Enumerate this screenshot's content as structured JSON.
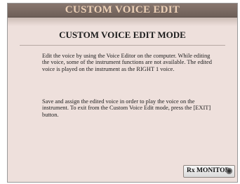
{
  "window": {
    "title": "CUSTOM VOICE EDIT"
  },
  "content": {
    "heading": "CUSTOM VOICE EDIT MODE",
    "paragraph1": "Edit the voice by using the Voice Editor on the computer. While editing the voice, some of the instrument functions are not available. The edited voice is played on the instrument as the RIGHT 1 voice.",
    "paragraph2": "Save and assign the edited voice in order to play the voice on the instrument. To exit from the Custom Voice Edit mode, press the [EXIT] button."
  },
  "monitor": {
    "label": "Rx MONITOR",
    "lamp_icon": "monitor-lamp-icon"
  }
}
